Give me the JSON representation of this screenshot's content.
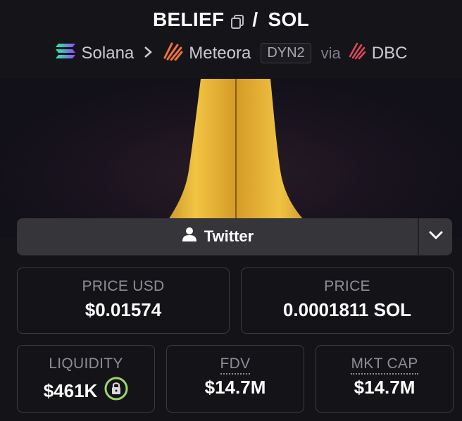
{
  "header": {
    "base_token": "BELIEF",
    "separator": "/",
    "quote_token": "SOL",
    "chain": "Solana",
    "dex": "Meteora",
    "pool_type": "DYN2",
    "via_label": "via",
    "via_source": "DBC"
  },
  "socials": {
    "twitter_label": "Twitter"
  },
  "stats": {
    "price_usd": {
      "label": "PRICE USD",
      "value": "$0.01574"
    },
    "price_native": {
      "label": "PRICE",
      "value": "0.0001811 SOL"
    },
    "liquidity": {
      "label": "LIQUIDITY",
      "value": "$461K"
    },
    "fdv": {
      "label": "FDV",
      "value": "$14.7M"
    },
    "mkt_cap": {
      "label": "MKT CAP",
      "value": "$14.7M"
    }
  },
  "colors": {
    "lock_ring": "#9bd66b",
    "solana_gradient": [
      "#9945FF",
      "#19FB9B"
    ],
    "meteora_orange": "#f0713a",
    "dbc_red": "#e0485a"
  }
}
